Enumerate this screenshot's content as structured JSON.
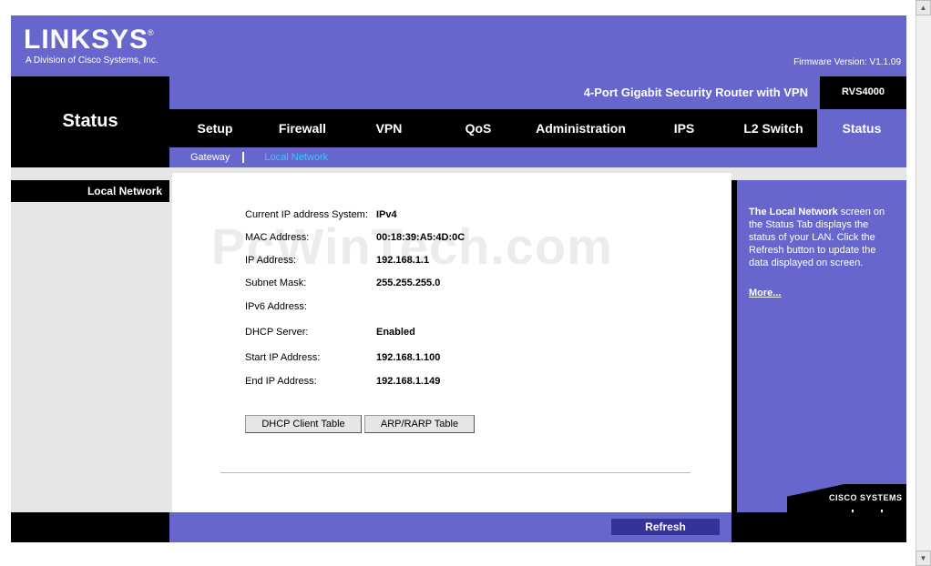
{
  "header": {
    "logo": "LINKSYS",
    "logo_mark": "®",
    "logo_sub": "A Division of Cisco Systems, Inc.",
    "firmware": "Firmware Version: V1.1.09",
    "product_name": "4-Port Gigabit Security Router with VPN",
    "model": "RVS4000"
  },
  "page_title": "Status",
  "nav": {
    "tabs": [
      {
        "label": "Setup"
      },
      {
        "label": "Firewall"
      },
      {
        "label": "VPN"
      },
      {
        "label": "QoS"
      },
      {
        "label": "Administration"
      },
      {
        "label": "IPS"
      },
      {
        "label": "L2 Switch"
      },
      {
        "label": "Status",
        "active": true
      }
    ],
    "subtabs": [
      {
        "label": "Gateway"
      },
      {
        "label": "Local Network",
        "active": true
      }
    ]
  },
  "section_label": "Local Network",
  "watermark": "PcWinTech.com",
  "fields": [
    {
      "label": "Current IP address System:",
      "value": "IPv4"
    },
    {
      "label": "MAC Address:",
      "value": "00:18:39:A5:4D:0C"
    },
    {
      "label": "IP Address:",
      "value": "192.168.1.1"
    },
    {
      "label": "Subnet Mask:",
      "value": "255.255.255.0"
    },
    {
      "label": "IPv6 Address:",
      "value": ""
    },
    {
      "label": "DHCP Server:",
      "value": "Enabled"
    },
    {
      "label": "Start IP Address:",
      "value": "192.168.1.100"
    },
    {
      "label": "End IP Address:",
      "value": "192.168.1.149"
    }
  ],
  "buttons": {
    "dhcp_client_table": "DHCP Client Table",
    "arp_rarp_table": "ARP/RARP Table",
    "refresh": "Refresh"
  },
  "help": {
    "bold": "The Local Network",
    "text": " screen on the Status Tab displays the status of your LAN. Click the Refresh button to update the data displayed on screen.",
    "more": "More..."
  },
  "footer_logo": "CISCO SYSTEMS",
  "colors": {
    "brand_purple": "#6666cc",
    "refresh_blue": "#333399",
    "active_subtab": "#33ccff"
  }
}
